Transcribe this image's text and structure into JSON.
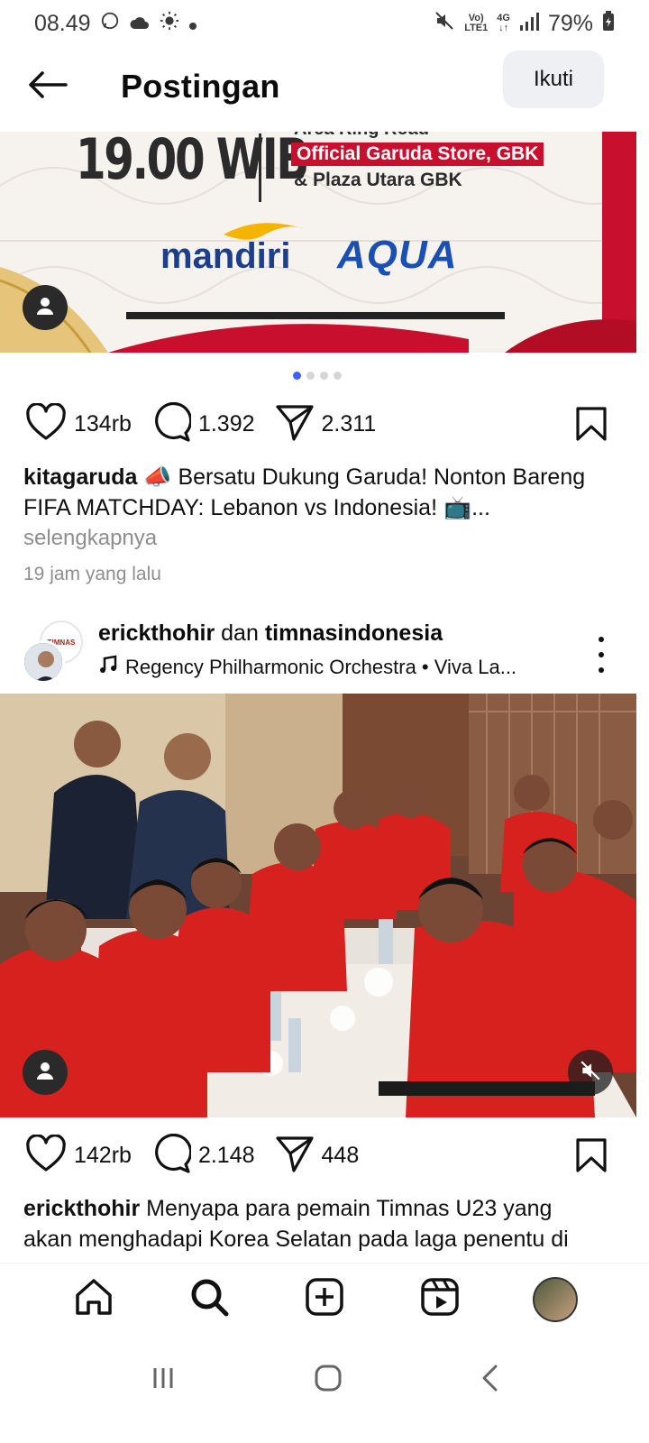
{
  "status_bar": {
    "time": "08.49",
    "network_top": "Vo)",
    "network_bottom": "LTE1",
    "gen": "4G",
    "battery": "79%"
  },
  "header": {
    "title": "Postingan",
    "follow_label": "Ikuti"
  },
  "post1": {
    "banner": {
      "time_text": "19.00 WIB",
      "venue_top": "Area Ring Road",
      "venue_highlight": "Official Garuda Store, GBK",
      "venue_bottom": "& Plaza Utara GBK",
      "sponsor1": "mandiri",
      "sponsor2": "AQUA"
    },
    "carousel_count": 4,
    "likes": "134rb",
    "comments": "1.392",
    "shares": "2.311",
    "username": "kitagaruda",
    "caption_line1": "📣 Bersatu Dukung Garuda! Nonton Bareng",
    "caption_line2": "FIFA MATCHDAY: Lebanon vs Indonesia! 📺...",
    "more_label": "selengkapnya",
    "time_ago": "19 jam yang lalu"
  },
  "post2": {
    "user1": "erickthohir",
    "connector": "dan",
    "user2": "timnasindonesia",
    "music": "Regency Philharmonic Orchestra • Viva La...",
    "collab_badge": "TIMNAS",
    "likes": "142rb",
    "comments": "2.148",
    "shares": "448",
    "username": "erickthohir",
    "caption_line1": "Menyapa para pemain Timnas U23 yang",
    "caption_line2": "akan menghadapi Korea Selatan pada laga penentu di"
  },
  "colors": {
    "accent_dot": "#3b62ff",
    "banner_red": "#c8102e",
    "jersey_red": "#d6211f"
  },
  "icons": [
    "back-arrow-icon",
    "heart-icon",
    "comment-icon",
    "share-icon",
    "bookmark-icon",
    "music-note-icon",
    "more-vertical-icon",
    "home-icon",
    "search-icon",
    "create-icon",
    "reels-icon",
    "mute-icon",
    "person-icon"
  ]
}
